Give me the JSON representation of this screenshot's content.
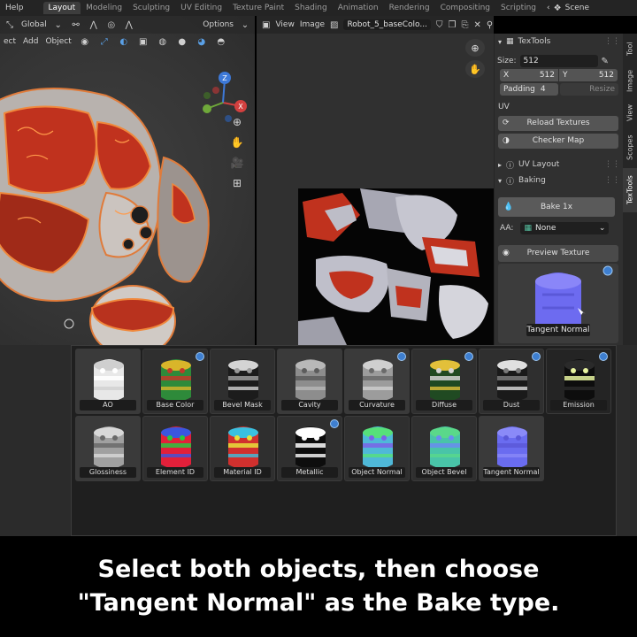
{
  "menubar": {
    "items": [
      "Help"
    ],
    "workspaces": [
      {
        "label": "Layout",
        "active": true
      },
      {
        "label": "Modeling",
        "active": false
      },
      {
        "label": "Sculpting",
        "active": false
      },
      {
        "label": "UV Editing",
        "active": false
      },
      {
        "label": "Texture Paint",
        "active": false
      },
      {
        "label": "Shading",
        "active": false
      },
      {
        "label": "Animation",
        "active": false
      },
      {
        "label": "Rendering",
        "active": false
      },
      {
        "label": "Compositing",
        "active": false
      },
      {
        "label": "Scripting",
        "active": false
      }
    ],
    "scene_label": "Scene"
  },
  "viewport": {
    "orientation": "Global",
    "options_label": "Options",
    "menu": [
      "ect",
      "Add",
      "Object"
    ]
  },
  "image_editor": {
    "menu": [
      "View",
      "Image"
    ],
    "image_name": "Robot_5_baseColo..."
  },
  "textools": {
    "panel_title": "TexTools",
    "size_label": "Size:",
    "size_value": "512",
    "x_label": "X",
    "x_value": "512",
    "y_label": "Y",
    "y_value": "512",
    "padding_label": "Padding",
    "padding_value": "4",
    "resize_label": "Resize",
    "uv_section": "UV",
    "reload_textures": "Reload Textures",
    "checker_map": "Checker Map",
    "uv_layout": "UV Layout",
    "baking": "Baking",
    "bake_button": "Bake 1x",
    "aa_label": "AA:",
    "aa_value": "None",
    "preview_texture": "Preview Texture",
    "preview_label": "Tangent Normal"
  },
  "sidebar_tabs": [
    "Tool",
    "Image",
    "View",
    "Scopes",
    "TexTools"
  ],
  "bake_modes": [
    {
      "label": "AO",
      "badge": false
    },
    {
      "label": "Base Color",
      "badge": true
    },
    {
      "label": "Bevel Mask",
      "badge": false
    },
    {
      "label": "Cavity",
      "badge": false
    },
    {
      "label": "Curvature",
      "badge": true
    },
    {
      "label": "Diffuse",
      "badge": true
    },
    {
      "label": "Dust",
      "badge": true
    },
    {
      "label": "Emission",
      "badge": true
    },
    {
      "label": "Glossiness",
      "badge": false
    },
    {
      "label": "Element ID",
      "badge": false
    },
    {
      "label": "Material ID",
      "badge": false
    },
    {
      "label": "Metallic",
      "badge": true
    },
    {
      "label": "Object Normal",
      "badge": false
    },
    {
      "label": "Object Bevel",
      "badge": false
    },
    {
      "label": "Tangent Normal",
      "badge": false
    }
  ],
  "caption": {
    "line1": "Select both objects, then choose",
    "line2": "\"Tangent Normal\" as the Bake type."
  },
  "colors": {
    "accent_blue": "#3e7fd0",
    "active_tab": "#3d3d3d",
    "mesh_red": "#c0321e",
    "mesh_grey": "#c9c9c9"
  }
}
